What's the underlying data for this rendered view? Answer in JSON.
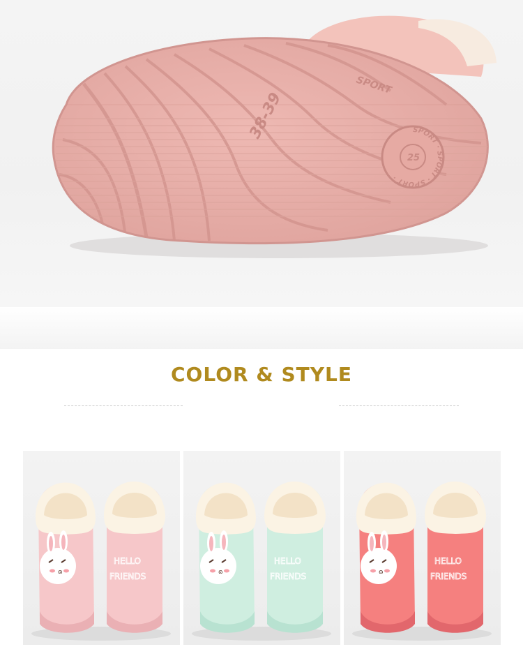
{
  "sole_photo": {
    "size_mark": "38-39",
    "brand_text": "SPORT",
    "stamp_ring_text": "SPORT · SPORT · SPORT ·",
    "stamp_center": "25",
    "colors": {
      "sole": "#eab4ae",
      "groove": "#d99891",
      "upper": "#f3c3bb"
    }
  },
  "section": {
    "title": "COLOR & STYLE",
    "title_color": "#b08a1e"
  },
  "variants": [
    {
      "color_name": "pink",
      "body": "#f6c7c9",
      "dark": "#eab0b4",
      "embroidery_line1": "HELLO",
      "embroidery_line2": "FRIENDS",
      "text_color": "#ffffff"
    },
    {
      "color_name": "mint",
      "body": "#cfeee0",
      "dark": "#b8e2d1",
      "embroidery_line1": "HELLO",
      "embroidery_line2": "FRIENDS",
      "text_color": "#ffffff"
    },
    {
      "color_name": "coral",
      "body": "#f5807f",
      "dark": "#e2676c",
      "embroidery_line1": "HELLO",
      "embroidery_line2": "FRIENDS",
      "text_color": "#ffffff"
    }
  ],
  "icons": [
    "bunny-face-icon"
  ]
}
